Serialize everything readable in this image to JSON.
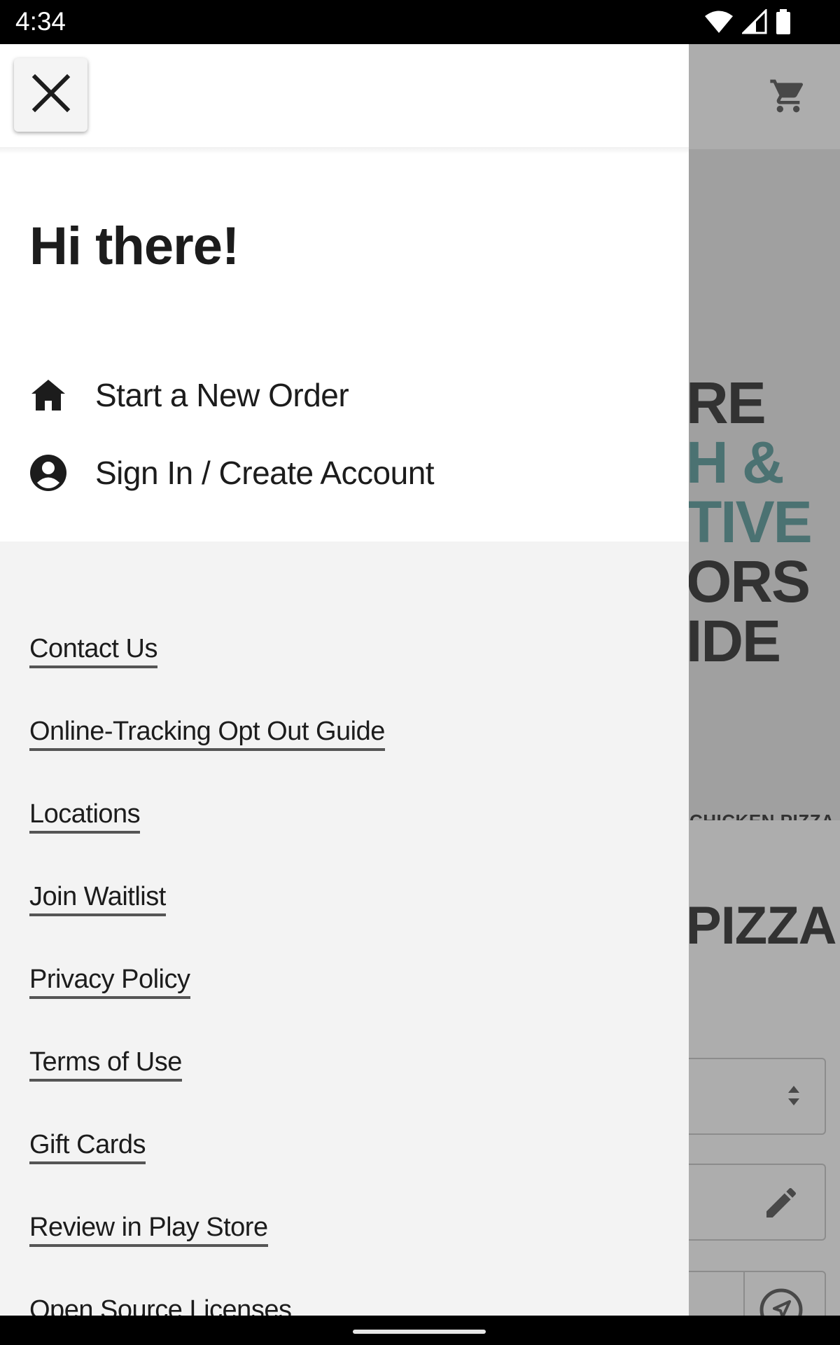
{
  "status_bar": {
    "time": "4:34",
    "icons": [
      "wifi-icon",
      "signal-icon",
      "battery-icon"
    ]
  },
  "background": {
    "hero_lines": [
      "RE",
      "H &",
      "TIVE",
      "ORS",
      "IDE"
    ],
    "hero_tab": "CHICKEN PIZZA",
    "section_title": "PIZZA",
    "icons": [
      "cart-icon",
      "sort-arrows-icon",
      "pencil-icon",
      "location-arrow-icon"
    ]
  },
  "drawer": {
    "close_icon": "close-icon",
    "greeting": "Hi there!",
    "nav": [
      {
        "label": "Start a New Order",
        "icon": "home-icon"
      },
      {
        "label": "Sign In / Create Account",
        "icon": "account-circle-icon"
      }
    ],
    "links": [
      "Contact Us",
      "Online-Tracking Opt Out Guide",
      "Locations",
      "Join Waitlist",
      "Privacy Policy",
      "Terms of Use",
      "Gift Cards",
      "Review in Play Store",
      "Open Source Licenses"
    ]
  },
  "colors": {
    "accent_teal": "#6fa9a8",
    "accent_yellow": "#e4c44a",
    "text_dark": "#1c1c1c"
  }
}
